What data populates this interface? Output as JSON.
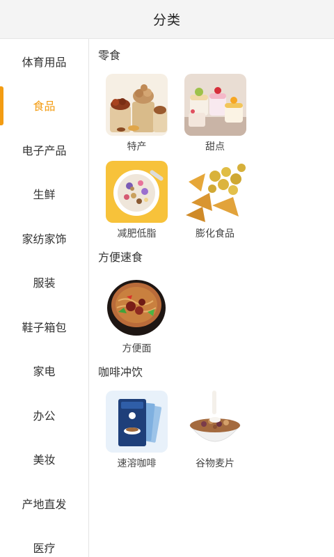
{
  "header": {
    "title": "分类"
  },
  "sidebar": {
    "items": [
      {
        "label": "体育用品",
        "active": false
      },
      {
        "label": "食品",
        "active": true
      },
      {
        "label": "电子产品",
        "active": false
      },
      {
        "label": "生鲜",
        "active": false
      },
      {
        "label": "家纺家饰",
        "active": false
      },
      {
        "label": "服装",
        "active": false
      },
      {
        "label": "鞋子箱包",
        "active": false
      },
      {
        "label": "家电",
        "active": false
      },
      {
        "label": "办公",
        "active": false
      },
      {
        "label": "美妆",
        "active": false
      },
      {
        "label": "产地直发",
        "active": false
      },
      {
        "label": "医疗",
        "active": false
      }
    ]
  },
  "sections": [
    {
      "title": "零食",
      "items": [
        {
          "label": "特产",
          "icon": "nuts-snack-icon"
        },
        {
          "label": "甜点",
          "icon": "dessert-icon"
        },
        {
          "label": "减肥低脂",
          "icon": "yogurt-bowl-icon"
        },
        {
          "label": "膨化食品",
          "icon": "puffed-snack-icon"
        }
      ]
    },
    {
      "title": "方便速食",
      "items": [
        {
          "label": "方便面",
          "icon": "noodle-bowl-icon"
        }
      ]
    },
    {
      "title": "咖啡冲饮",
      "items": [
        {
          "label": "速溶咖啡",
          "icon": "coffee-box-icon"
        },
        {
          "label": "谷物麦片",
          "icon": "cereal-bowl-icon"
        }
      ]
    }
  ],
  "colors": {
    "accent": "#f39c12",
    "header_bg": "#f4f4f4"
  }
}
